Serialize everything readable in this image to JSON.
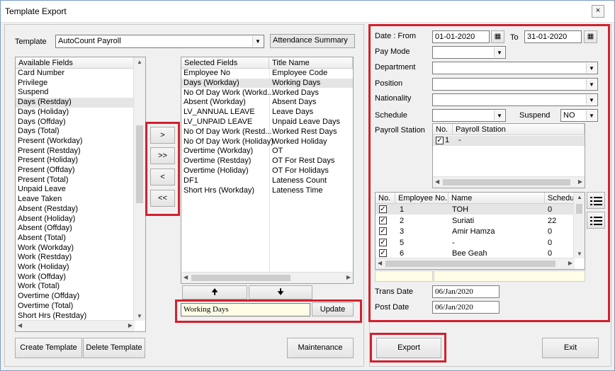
{
  "window": {
    "title": "Template Export",
    "close_glyph": "×"
  },
  "left": {
    "template_label": "Template",
    "template_value": "AutoCount Payroll",
    "attendance_summary": "Attendance Summary",
    "available_header": "Available Fields",
    "available_fields": [
      "Card Number",
      "Privilege",
      "Suspend",
      "Days (Restday)",
      "Days (Holiday)",
      "Days (Offday)",
      "Days (Total)",
      "Present (Workday)",
      "Present (Restday)",
      "Present (Holiday)",
      "Present (Offday)",
      "Present (Total)",
      "Unpaid Leave",
      "Leave Taken",
      "Absent (Restday)",
      "Absent (Holiday)",
      "Absent (Offday)",
      "Absent (Total)",
      "Work (Workday)",
      "Work (Restday)",
      "Work (Holiday)",
      "Work (Offday)",
      "Work (Total)",
      "Overtime (Offday)",
      "Overtime (Total)",
      "Short Hrs (Restday)"
    ],
    "available_selected_index": 3,
    "move_buttons": [
      ">",
      ">>",
      "<",
      "<<"
    ],
    "selected_headers": [
      "Selected Fields",
      "Title Name"
    ],
    "selected_rows": [
      [
        "Employee No",
        "Employee Code"
      ],
      [
        "Days (Workday)",
        "Working Days"
      ],
      [
        "No Of Day Work (Workd...",
        "Worked Days"
      ],
      [
        "Absent (Workday)",
        "Absent Days"
      ],
      [
        "LV_ANNUAL LEAVE",
        "Leave Days"
      ],
      [
        "LV_UNPAID LEAVE",
        "Unpaid Leave Days"
      ],
      [
        "No Of Day Work (Restd...",
        "Worked Rest Days"
      ],
      [
        "No Of Day Work (Holiday)",
        "Worked Holiday"
      ],
      [
        "Overtime (Workday)",
        "OT"
      ],
      [
        "Overtime (Restday)",
        "OT For Rest Days"
      ],
      [
        "Overtime (Holiday)",
        "OT For Holidays"
      ],
      [
        "DF1",
        "Lateness Count"
      ],
      [
        "Short Hrs (Workday)",
        "Lateness Time"
      ]
    ],
    "selected_row_highlight": 1,
    "up_glyph": "🠉",
    "down_glyph": "🠋",
    "title_edit_value": "Working Days",
    "update_label": "Update",
    "create_template": "Create Template",
    "delete_template": "Delete Template",
    "maintenance": "Maintenance"
  },
  "right": {
    "date_from_label": "Date : From",
    "date_from": "01-01-2020",
    "to_label": "To",
    "date_to": "31-01-2020",
    "pay_mode_label": "Pay Mode",
    "department_label": "Department",
    "position_label": "Position",
    "nationality_label": "Nationality",
    "schedule_label": "Schedule",
    "suspend_label": "Suspend",
    "suspend_value": "NO",
    "payroll_station_label": "Payroll Station",
    "station_headers": [
      "No.",
      "Payroll Station"
    ],
    "station_rows": [
      {
        "checked": true,
        "no": "1",
        "name": "-"
      }
    ],
    "emp_headers": [
      "No.",
      "Employee No.",
      "Name",
      "Schedule"
    ],
    "employees": [
      {
        "checked": true,
        "no": "1",
        "name": "TOH",
        "schedule": "0"
      },
      {
        "checked": true,
        "no": "2",
        "name": "Suriati",
        "schedule": "22"
      },
      {
        "checked": true,
        "no": "3",
        "name": "Amir Hamza",
        "schedule": "0"
      },
      {
        "checked": true,
        "no": "5",
        "name": "-",
        "schedule": "0"
      },
      {
        "checked": true,
        "no": "6",
        "name": "Bee Geah",
        "schedule": "0"
      }
    ],
    "trans_date_label": "Trans Date",
    "trans_date": "06/Jan/2020",
    "post_date_label": "Post Date",
    "post_date": "06/Jan/2020",
    "export_label": "Export",
    "exit_label": "Exit"
  },
  "colors": {
    "highlight": "#d3202d",
    "selection": "#e5e5e5",
    "footer_yellow": "#fffde6"
  }
}
